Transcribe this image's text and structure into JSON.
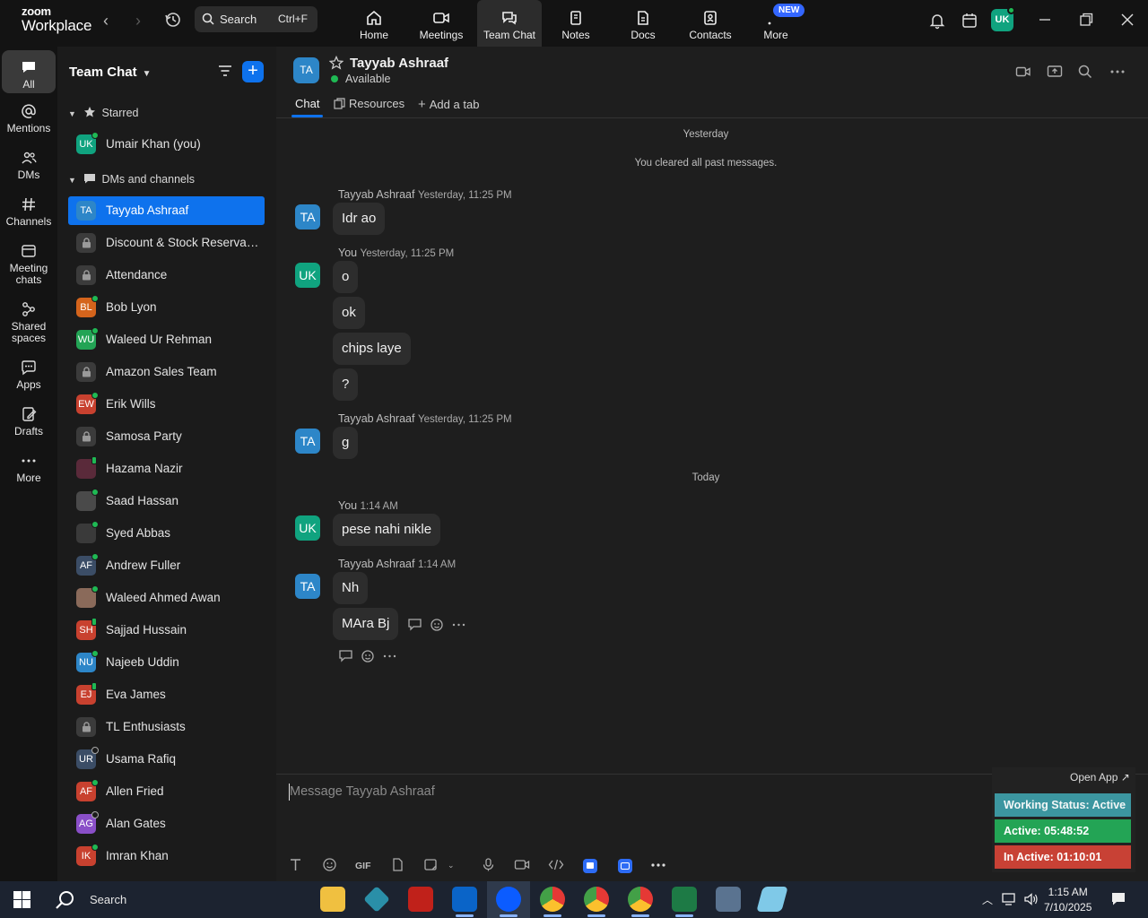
{
  "app": {
    "brand_top": "zoom",
    "brand_bottom": "Workplace",
    "search_label": "Search",
    "search_shortcut": "Ctrl+F",
    "new_badge": "NEW",
    "user_initials": "UK",
    "nav_tabs": [
      {
        "label": "Home",
        "icon": "home-icon"
      },
      {
        "label": "Meetings",
        "icon": "video-camera-icon"
      },
      {
        "label": "Team Chat",
        "icon": "chat-icon"
      },
      {
        "label": "Notes",
        "icon": "notes-icon"
      },
      {
        "label": "Docs",
        "icon": "docs-icon"
      },
      {
        "label": "Contacts",
        "icon": "contacts-icon"
      },
      {
        "label": "More",
        "icon": "more-icon"
      }
    ]
  },
  "rail": [
    {
      "label": "All",
      "icon": "chat-bubble-icon"
    },
    {
      "label": "Mentions",
      "icon": "at-icon"
    },
    {
      "label": "DMs",
      "icon": "people-icon"
    },
    {
      "label": "Channels",
      "icon": "hash-icon"
    },
    {
      "label": "Meeting chats",
      "icon": "calendar-chat-icon"
    },
    {
      "label": "Shared spaces",
      "icon": "shared-spaces-icon"
    },
    {
      "label": "Apps",
      "icon": "apps-icon"
    },
    {
      "label": "Drafts",
      "icon": "drafts-icon"
    },
    {
      "label": "More",
      "icon": "ellipsis-icon"
    }
  ],
  "sidebar": {
    "title": "Team Chat",
    "starred_label": "Starred",
    "dms_label": "DMs and channels",
    "starred": [
      {
        "name": "Umair Khan (you)",
        "initials": "UK",
        "color": "#10a37f",
        "status": "online"
      }
    ],
    "items": [
      {
        "name": "Tayyab Ashraaf",
        "initials": "TA",
        "color": "#2d86c8",
        "status": "none",
        "selected": true
      },
      {
        "name": "Discount & Stock Reservati...",
        "initials": "",
        "color": "#3b3b3b",
        "status": "lock"
      },
      {
        "name": "Attendance",
        "initials": "",
        "color": "#3b3b3b",
        "status": "lock"
      },
      {
        "name": "Bob Lyon",
        "initials": "BL",
        "color": "#d4641c",
        "status": "online"
      },
      {
        "name": "Waleed Ur Rehman",
        "initials": "WU",
        "color": "#23a455",
        "status": "online"
      },
      {
        "name": "Amazon Sales Team",
        "initials": "",
        "color": "#3b3b3b",
        "status": "lock"
      },
      {
        "name": "Erik Wills",
        "initials": "EW",
        "color": "#c8412f",
        "status": "online"
      },
      {
        "name": "Samosa Party",
        "initials": "",
        "color": "#3b3b3b",
        "status": "lock"
      },
      {
        "name": "Hazama Nazir",
        "initials": "",
        "color": "#5a2a3a",
        "status": "mobile"
      },
      {
        "name": "Saad Hassan",
        "initials": "",
        "color": "#4a4a4a",
        "status": "online"
      },
      {
        "name": "Syed Abbas",
        "initials": "",
        "color": "#3a3a3a",
        "status": "online"
      },
      {
        "name": "Andrew Fuller",
        "initials": "AF",
        "color": "#3b4d66",
        "status": "online"
      },
      {
        "name": "Waleed Ahmed Awan",
        "initials": "",
        "color": "#8a6a5a",
        "status": "online"
      },
      {
        "name": "Sajjad Hussain",
        "initials": "SH",
        "color": "#c8412f",
        "status": "mobile"
      },
      {
        "name": "Najeeb Uddin",
        "initials": "NU",
        "color": "#2d86c8",
        "status": "online"
      },
      {
        "name": "Eva James",
        "initials": "EJ",
        "color": "#c8412f",
        "status": "mobile"
      },
      {
        "name": "TL Enthusiasts",
        "initials": "",
        "color": "#3b3b3b",
        "status": "lock"
      },
      {
        "name": "Usama Rafiq",
        "initials": "UR",
        "color": "#3b4d66",
        "status": "away"
      },
      {
        "name": "Allen Fried",
        "initials": "AF",
        "color": "#c8412f",
        "status": "online"
      },
      {
        "name": "Alan Gates",
        "initials": "AG",
        "color": "#8a4fc8",
        "status": "away"
      },
      {
        "name": "Imran Khan",
        "initials": "IK",
        "color": "#c8412f",
        "status": "online"
      }
    ]
  },
  "chat": {
    "contact_name": "Tayyab Ashraaf",
    "contact_initials": "TA",
    "contact_status": "Available",
    "tabs": [
      "Chat",
      "Resources",
      "Add a tab"
    ],
    "day_yesterday": "Yesterday",
    "system_message": "You cleared all past messages.",
    "day_today": "Today",
    "groups": [
      {
        "sender": "Tayyab Ashraaf",
        "time": "Yesterday, 11:25 PM",
        "initials": "TA",
        "messages": [
          "Idr ao"
        ]
      },
      {
        "sender": "You",
        "time": "Yesterday, 11:25 PM",
        "initials": "UK",
        "messages": [
          "o",
          "ok",
          "chips laye",
          "?"
        ]
      },
      {
        "sender": "Tayyab Ashraaf",
        "time": "Yesterday, 11:25 PM",
        "initials": "TA",
        "messages": [
          "g"
        ]
      },
      {
        "sender": "You",
        "time": "1:14 AM",
        "initials": "UK",
        "messages": [
          "pese nahi nikle"
        ]
      },
      {
        "sender": "Tayyab Ashraaf",
        "time": "1:14 AM",
        "initials": "TA",
        "messages": [
          "Nh",
          "MAra Bj"
        ]
      }
    ],
    "composer_placeholder": "Message Tayyab Ashraaf",
    "composer_gif": "GIF"
  },
  "widget": {
    "open_app": "Open App ↗",
    "working_status": "Working Status: Active",
    "active": "Active: 05:48:52",
    "inactive": "In Active: 01:10:01"
  },
  "taskbar": {
    "search_label": "Search",
    "time": "1:15 AM",
    "date": "7/10/2025"
  }
}
